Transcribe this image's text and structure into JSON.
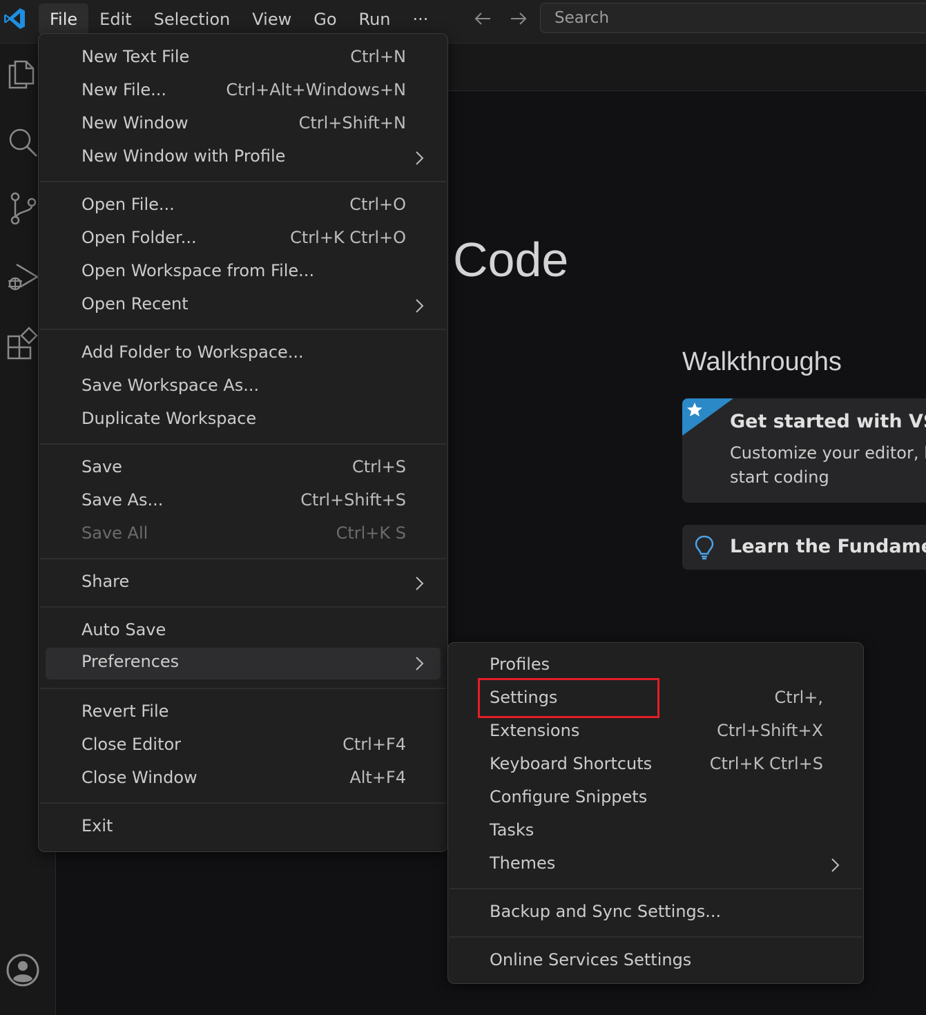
{
  "menubar": {
    "items": [
      "File",
      "Edit",
      "Selection",
      "View",
      "Go",
      "Run"
    ],
    "overflow": "···"
  },
  "search": {
    "label": "Search"
  },
  "editor": {
    "hero_title": "Code",
    "walkthroughs_title": "Walkthroughs",
    "card1": {
      "title": "Get started with VS Co",
      "desc": "Customize your editor, le start coding"
    },
    "card2": {
      "title": "Learn the Fundamenta"
    }
  },
  "file_menu": {
    "new_text_file": {
      "label": "New Text File",
      "kb": "Ctrl+N"
    },
    "new_file": {
      "label": "New File...",
      "kb": "Ctrl+Alt+Windows+N"
    },
    "new_window": {
      "label": "New Window",
      "kb": "Ctrl+Shift+N"
    },
    "new_window_profile": {
      "label": "New Window with Profile"
    },
    "open_file": {
      "label": "Open File...",
      "kb": "Ctrl+O"
    },
    "open_folder": {
      "label": "Open Folder...",
      "kb": "Ctrl+K Ctrl+O"
    },
    "open_workspace": {
      "label": "Open Workspace from File..."
    },
    "open_recent": {
      "label": "Open Recent"
    },
    "add_folder": {
      "label": "Add Folder to Workspace..."
    },
    "save_workspace_as": {
      "label": "Save Workspace As..."
    },
    "duplicate_workspace": {
      "label": "Duplicate Workspace"
    },
    "save": {
      "label": "Save",
      "kb": "Ctrl+S"
    },
    "save_as": {
      "label": "Save As...",
      "kb": "Ctrl+Shift+S"
    },
    "save_all": {
      "label": "Save All",
      "kb": "Ctrl+K S"
    },
    "share": {
      "label": "Share"
    },
    "auto_save": {
      "label": "Auto Save"
    },
    "preferences": {
      "label": "Preferences"
    },
    "revert_file": {
      "label": "Revert File"
    },
    "close_editor": {
      "label": "Close Editor",
      "kb": "Ctrl+F4"
    },
    "close_window": {
      "label": "Close Window",
      "kb": "Alt+F4"
    },
    "exit": {
      "label": "Exit"
    }
  },
  "pref_menu": {
    "profiles": {
      "label": "Profiles"
    },
    "settings": {
      "label": "Settings",
      "kb": "Ctrl+,"
    },
    "extensions": {
      "label": "Extensions",
      "kb": "Ctrl+Shift+X"
    },
    "keyboard_shortcuts": {
      "label": "Keyboard Shortcuts",
      "kb": "Ctrl+K Ctrl+S"
    },
    "configure_snippets": {
      "label": "Configure Snippets"
    },
    "tasks": {
      "label": "Tasks"
    },
    "themes": {
      "label": "Themes"
    },
    "backup_sync": {
      "label": "Backup and Sync Settings..."
    },
    "online_services": {
      "label": "Online Services Settings"
    }
  },
  "colors": {
    "accent": "#0078d4",
    "highlight_box": "#e51d25",
    "menu_bg": "#202020",
    "editor_bg": "#111114"
  }
}
